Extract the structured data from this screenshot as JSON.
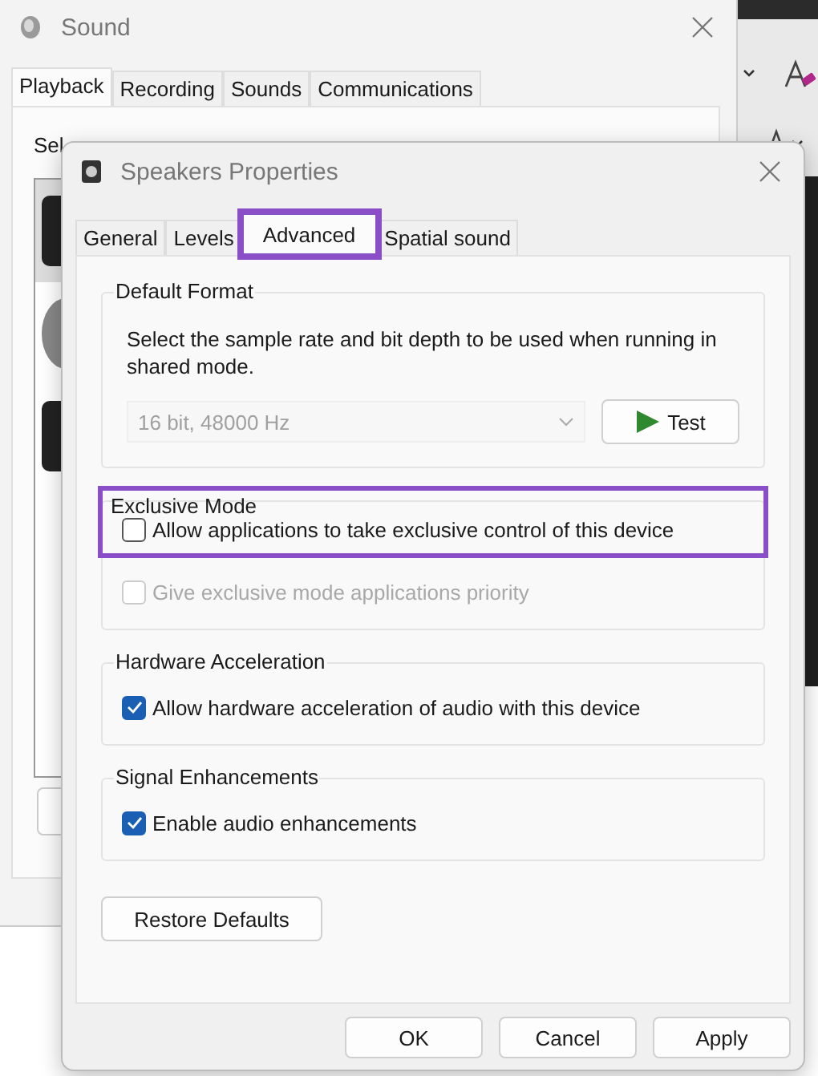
{
  "sound_window": {
    "title": "Sound",
    "tabs": [
      {
        "label": "Playback",
        "selected": true
      },
      {
        "label": "Recording",
        "selected": false
      },
      {
        "label": "Sounds",
        "selected": false
      },
      {
        "label": "Communications",
        "selected": false
      }
    ],
    "instruction": "Sel"
  },
  "dialog": {
    "title": "Speakers Properties",
    "tabs": [
      {
        "label": "General",
        "selected": false,
        "highlighted": false
      },
      {
        "label": "Levels",
        "selected": false,
        "highlighted": false
      },
      {
        "label": "Advanced",
        "selected": true,
        "highlighted": true
      },
      {
        "label": "Spatial sound",
        "selected": false,
        "highlighted": false
      }
    ],
    "groups": [
      {
        "kind": "format",
        "title": "Default Format",
        "highlighted": false,
        "description": "Select the sample rate and bit depth to be used when running in shared mode.",
        "format_select": {
          "value": "16 bit, 48000 Hz",
          "disabled": true
        },
        "test_button": "Test"
      },
      {
        "kind": "checks",
        "title": "Exclusive Mode",
        "highlighted": true,
        "options": [
          {
            "label": "Allow applications to take exclusive control of this device",
            "checked": false,
            "disabled": false
          },
          {
            "label": "Give exclusive mode applications priority",
            "checked": false,
            "disabled": true
          }
        ]
      },
      {
        "kind": "checks",
        "title": "Hardware Acceleration",
        "highlighted": false,
        "options": [
          {
            "label": "Allow hardware acceleration of audio with this device",
            "checked": true,
            "disabled": false
          }
        ]
      },
      {
        "kind": "checks",
        "title": "Signal Enhancements",
        "highlighted": false,
        "options": [
          {
            "label": "Enable audio enhancements",
            "checked": true,
            "disabled": false
          }
        ]
      }
    ],
    "restore_button": "Restore Defaults",
    "buttons": [
      "OK",
      "Cancel",
      "Apply"
    ]
  }
}
